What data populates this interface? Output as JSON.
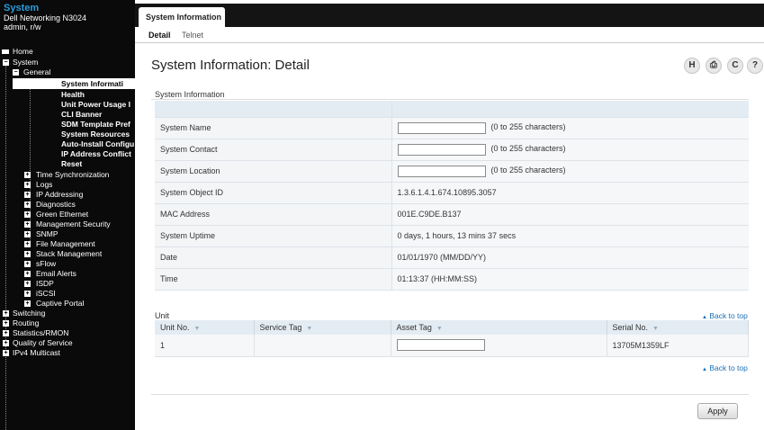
{
  "sidebar": {
    "title": "System",
    "device": "Dell Networking N3024",
    "user": "admin, r/w",
    "items": {
      "home": "Home",
      "system": "System",
      "general": "General",
      "system_information": "System Informati",
      "health": "Health",
      "unit_power": "Unit Power Usage I",
      "cli_banner": "CLI Banner",
      "sdm": "SDM Template Pref",
      "system_resources": "System Resources",
      "auto_install": "Auto-Install Configu",
      "ip_conflict": "IP Address Conflict",
      "reset": "Reset",
      "time_sync": "Time Synchronization",
      "logs": "Logs",
      "ip_addressing": "IP Addressing",
      "diagnostics": "Diagnostics",
      "green_ethernet": "Green Ethernet",
      "mgmt_security": "Management Security",
      "snmp": "SNMP",
      "file_mgmt": "File Management",
      "stack_mgmt": "Stack Management",
      "sflow": "sFlow",
      "email_alerts": "Email Alerts",
      "isdp": "ISDP",
      "iscsi": "iSCSI",
      "captive_portal": "Captive Portal",
      "switching": "Switching",
      "routing": "Routing",
      "statistics": "Statistics/RMON",
      "qos": "Quality of Service",
      "ipv4_multicast": "IPv4 Multicast"
    }
  },
  "header": {
    "tab": "System Information",
    "subtabs": {
      "detail": "Detail",
      "telnet": "Telnet"
    }
  },
  "main": {
    "title": "System Information: Detail",
    "section": "System Information",
    "rows": [
      {
        "label": "System Name",
        "input": "",
        "hint": "(0 to 255 characters)"
      },
      {
        "label": "System Contact",
        "input": "",
        "hint": "(0 to 255 characters)"
      },
      {
        "label": "System Location",
        "input": "",
        "hint": "(0 to 255 characters)"
      },
      {
        "label": "System Object ID",
        "value": "1.3.6.1.4.1.674.10895.3057"
      },
      {
        "label": "MAC Address",
        "value": "001E.C9DE.B137"
      },
      {
        "label": "System Uptime",
        "value": "0 days, 1 hours, 13 mins 37 secs"
      },
      {
        "label": "Date",
        "value": "01/01/1970  (MM/DD/YY)"
      },
      {
        "label": "Time",
        "value": "01:13:37  (HH:MM:SS)"
      }
    ],
    "unit": {
      "label": "Unit",
      "back_to_top": "Back to top",
      "columns": [
        "Unit No.",
        "Service Tag",
        "Asset Tag",
        "Serial No."
      ],
      "row": {
        "unit_no": "1",
        "service_tag": "",
        "asset_tag": "",
        "serial_no": "13705M1359LF"
      }
    },
    "apply": "Apply"
  },
  "colors": {
    "sidebar_bg": "#0a0a0a",
    "title_accent": "#2b9bd9",
    "link": "#1b6fb5"
  },
  "icons": [
    "help-icon",
    "print-icon",
    "refresh-icon",
    "question-icon",
    "sort-icon",
    "back-to-top-arrow-icon"
  ]
}
